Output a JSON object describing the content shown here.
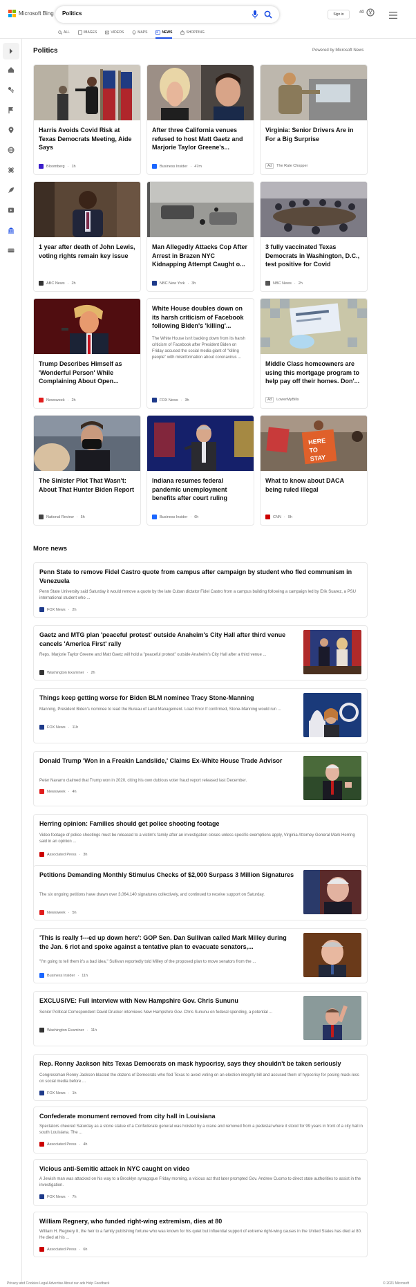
{
  "header": {
    "brand": "Microsoft Bing",
    "query": "Politics",
    "sign_in": "Sign in",
    "rewards": "40",
    "tabs": [
      "ALL",
      "IMAGES",
      "VIDEOS",
      "MAPS",
      "NEWS",
      "SHOPPING"
    ],
    "active_tab": "NEWS"
  },
  "colors": {
    "accent": "#174ae4",
    "logo": [
      "#f25022",
      "#7fba00",
      "#00a4ef",
      "#ffb900"
    ]
  },
  "rail": {
    "icons": [
      "expand-icon",
      "home-icon",
      "sports-icon",
      "flag-icon",
      "location-icon",
      "globe-icon",
      "science-icon",
      "rocket-icon",
      "video-icon",
      "politics-icon",
      "money-icon"
    ]
  },
  "section": {
    "title": "Politics",
    "powered_by": "Powered by Microsoft News"
  },
  "cards": [
    {
      "title": "Harris Avoids Covid Risk at Texas Democrats Meeting, Aide Says",
      "source": "Bloomberg",
      "age": "1h",
      "logo_color": "#3b1dca"
    },
    {
      "title": "After three California venues refused to host Matt Gaetz and Marjorie Taylor Greene's...",
      "source": "Business Insider",
      "age": "47m",
      "logo_color": "#1a66ff"
    },
    {
      "title": "Virginia: Senior Drivers Are in For a Big Surprise",
      "source": "The Rate Chopper",
      "age": "",
      "ad": "Ad"
    },
    {
      "title": "1 year after death of John Lewis, voting rights remain key issue",
      "source": "ABC News",
      "age": "2h",
      "logo_color": "#333333"
    },
    {
      "title": "Man Allegedly Attacks Cop After Arrest in Brazen NYC Kidnapping Attempt Caught o...",
      "source": "NBC New York",
      "age": "3h",
      "logo_color": "#1e3a8a"
    },
    {
      "title": "3 fully vaccinated Texas Democrats in Washington, D.C., test positive for Covid",
      "source": "NBC News",
      "age": "2h",
      "logo_color": "#555555"
    },
    {
      "title": "Trump Describes Himself as 'Wonderful Person' While Complaining About Open...",
      "source": "Newsweek",
      "age": "2h",
      "logo_color": "#e11d1d"
    },
    {
      "title": "White House doubles down on its harsh criticism of Facebook following Biden's 'killing'...",
      "description": "The White House isn't backing down from its harsh criticism of Facebook after President Biden on Friday accused the social media giant of \"killing people\" with misinformation about coronavirus ...",
      "source": "FOX News",
      "age": "3h",
      "logo_color": "#1e3a8a"
    },
    {
      "title": "Middle Class homeowners are using this mortgage program to help pay off their homes. Don'...",
      "source": "LowerMyBills",
      "age": "",
      "ad": "Ad"
    },
    {
      "title": "The Sinister Plot That Wasn't: About That Hunter Biden Report",
      "source": "National Review",
      "age": "5h",
      "logo_color": "#444444"
    },
    {
      "title": "Indiana resumes federal pandemic unemployment benefits after court ruling",
      "source": "Business Insider",
      "age": "6h",
      "logo_color": "#1a66ff"
    },
    {
      "title": "What to know about DACA being ruled illegal",
      "source": "CNN",
      "age": "9h",
      "logo_color": "#cc0000"
    }
  ],
  "more_news": {
    "title": "More news",
    "items": [
      {
        "title": "Penn State to remove Fidel Castro quote from campus after campaign by student who fled communism in Venezuela",
        "description": "Penn State University said Saturday it would remove a quote by the late Cuban dictator Fidel Castro from a campus building following a campaign led by Erik Suarez, a PSU international student who ...",
        "source": "FOX News",
        "age": "2h",
        "logo_color": "#1e3a8a"
      },
      {
        "title": "Gaetz and MTG plan 'peaceful protest' outside Anaheim's City Hall after third venue cancels 'America First' rally",
        "description": "Reps. Marjorie Taylor Greene and Matt Gaetz will hold a \"peaceful protest\" outside Anaheim's City Hall after a third venue ...",
        "source": "Washington Examiner",
        "age": "2h",
        "logo_color": "#333333"
      },
      {
        "title": "Things keep getting worse for Biden BLM nominee Tracy Stone-Manning",
        "description": "Manning, President Biden's nominee to lead the Bureau of Land Management. Load Error If confirmed, Stone-Manning would run ...",
        "source": "FOX News",
        "age": "11h",
        "logo_color": "#1e3a8a"
      },
      {
        "title": "Donald Trump 'Won in a Freakin Landslide,' Claims Ex-White House Trade Advisor",
        "description": "Peter Navarro claimed that Trump won in 2020, citing his own dubious voter fraud report released last December.",
        "source": "Newsweek",
        "age": "4h",
        "logo_color": "#e11d1d"
      },
      {
        "title": "Herring opinion: Families should get police shooting footage",
        "description": "Video footage of police shootings must be released to a victim's family after an investigation closes unless specific exemptions apply, Virginia Attorney General Mark Herring said in an opinion ...",
        "source": "Associated Press",
        "age": "3h",
        "logo_color": "#cc0000"
      },
      {
        "title": "Petitions Demanding Monthly Stimulus Checks of $2,000 Surpass 3 Million Signatures",
        "description": "The six ongoing petitions have drawn over 3,064,140 signatures collectively, and continued to receive support on Saturday.",
        "source": "Newsweek",
        "age": "5h",
        "logo_color": "#e11d1d"
      },
      {
        "title": "'This is really f---ed up down here': GOP Sen. Dan Sullivan called Mark Milley during the Jan. 6 riot and spoke against a tentative plan to evacuate senators,...",
        "description": "\"I'm going to tell them it's a bad idea,\" Sullivan reportedly told Milley of the proposed plan to move senators from the ...",
        "source": "Business Insider",
        "age": "11h",
        "logo_color": "#1a66ff"
      },
      {
        "title": "EXCLUSIVE: Full interview with New Hampshire Gov. Chris Sununu",
        "description": "Senior Political Correspondent David Drucker interviews New Hampshire Gov. Chris Sununu on federal spending, a potential ...",
        "source": "Washington Examiner",
        "age": "11h",
        "logo_color": "#333333"
      },
      {
        "title": "Rep. Ronny Jackson hits Texas Democrats on mask hypocrisy, says they shouldn't be taken seriously",
        "description": "Congressman Ronny Jackson blasted the dozens of Democrats who fled Texas to avoid voting on an election integrity bill and accused them of hypocrisy for posing mask-less on social media before ...",
        "source": "FOX News",
        "age": "1h",
        "logo_color": "#1e3a8a"
      },
      {
        "title": "Confederate monument removed from city hall in Louisiana",
        "description": "Spectators cheered Saturday as a stone statue of a Confederate general was hoisted by a crane and removed from a pedestal where it stood for 99 years in front of a city hall in south Louisiana. The ...",
        "source": "Associated Press",
        "age": "4h",
        "logo_color": "#cc0000"
      },
      {
        "title": "Vicious anti-Semitic attack in NYC caught on video",
        "description": "A Jewish man was attacked on his way to a Brooklyn synagogue Friday morning, a vicious act that later prompted Gov. Andrew Cuomo to direct state authorities to assist in the investigation.",
        "source": "FOX News",
        "age": "7h",
        "logo_color": "#1e3a8a"
      },
      {
        "title": "William Regnery, who funded right-wing extremism, dies at 80",
        "description": "William H. Regnery II, the heir to a family publishing fortune who was known for his quiet but influential support of extreme right-wing causes in the United States has died at 80. He died at his ...",
        "source": "Associated Press",
        "age": "6h",
        "logo_color": "#cc0000"
      }
    ]
  },
  "footer": {
    "left": "Privacy and Cookies   Legal   Advertise   About our ads   Help   Feedback",
    "right": "© 2021 Microsoft"
  }
}
